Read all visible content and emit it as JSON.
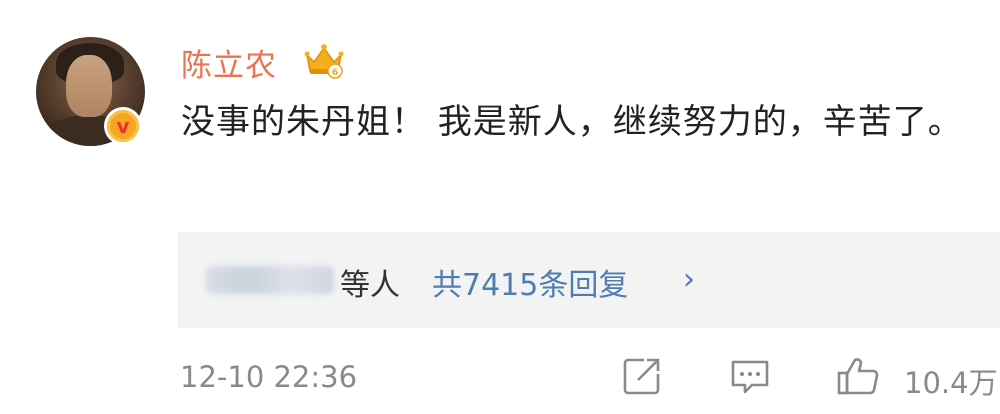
{
  "comment": {
    "username": "陈立农",
    "content": "没事的朱丹姐！ 我是新人，继续努力的，辛苦了。",
    "verified_badge": "v"
  },
  "replies": {
    "suffix": "等人",
    "count_text": "共7415条回复",
    "chevron": "›"
  },
  "footer": {
    "timestamp": "12-10 22:36",
    "like_count": "10.4万"
  },
  "icons": {
    "crown": "crown-icon",
    "share": "share-icon",
    "comment": "comment-icon",
    "like": "thumbs-up-icon"
  },
  "colors": {
    "username": "#eb7350",
    "link": "#4f7db3",
    "meta": "#8a8a8a",
    "reply_bg": "#f3f3f3"
  }
}
